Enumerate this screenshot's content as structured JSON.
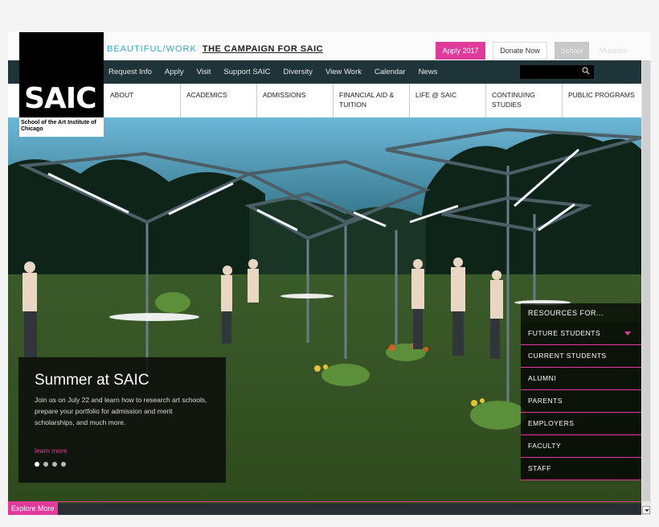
{
  "campaign": {
    "beautiful_work": "BEAUTIFUL/WORK",
    "campaign_text": "THE CAMPAIGN FOR SAIC"
  },
  "top_buttons": {
    "apply": "Apply 2017",
    "donate": "Donate Now",
    "school": "School",
    "museum": "Museum"
  },
  "utility_nav": [
    "Request Info",
    "Apply",
    "Visit",
    "Support SAIC",
    "Diversity",
    "View Work",
    "Calendar",
    "News"
  ],
  "logo": {
    "mark": "SAIC",
    "subtitle": "School of the Art Institute of Chicago"
  },
  "main_nav": [
    "About",
    "Academics",
    "Admissions",
    "Financial Aid & Tuition",
    "Life @ SAIC",
    "Continuing Studies",
    "Public Programs"
  ],
  "hero": {
    "title": "Summer at SAIC",
    "body": "Join us on July 22 and learn how to research art schools, prepare your portfolio for admission and merit scholarships, and much more.",
    "link": "learn more",
    "slide_count": 4,
    "active_slide": 1
  },
  "resources": {
    "heading": "RESOURCES FOR...",
    "items": [
      "FUTURE STUDENTS",
      "CURRENT STUDENTS",
      "ALUMNI",
      "PARENTS",
      "EMPLOYERS",
      "FACULTY",
      "STAFF"
    ]
  },
  "explore": "Explore More",
  "colors": {
    "accent": "#e03b9a",
    "nav_bg": "#1e3438",
    "campaign_blue": "#3aa7cf"
  },
  "icons": {
    "search": "search-icon",
    "dropdown": "chevron-down-icon"
  }
}
